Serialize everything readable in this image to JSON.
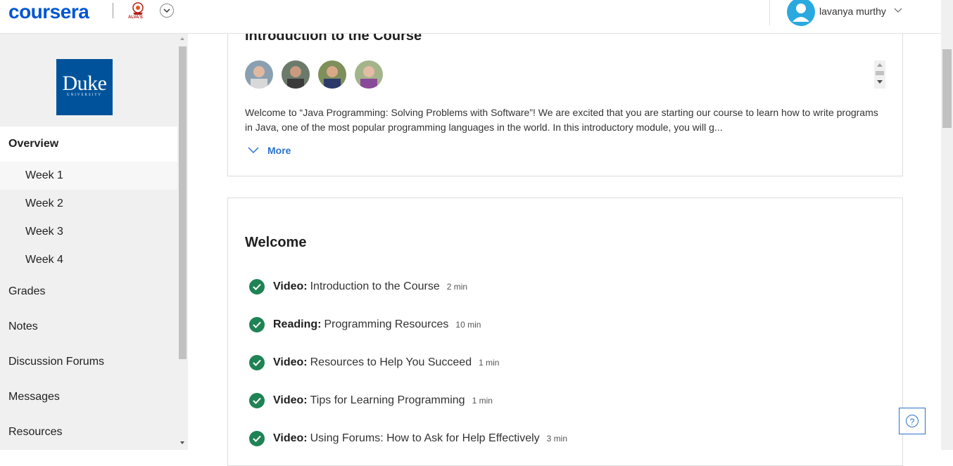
{
  "header": {
    "brand": "coursera",
    "partner_caption": "ALVA'S",
    "user_name": "lavanya murthy"
  },
  "sidebar": {
    "university_logo_text": "Duke",
    "university_logo_sub": "UNIVERSITY",
    "overview": "Overview",
    "weeks": [
      "Week 1",
      "Week 2",
      "Week 3",
      "Week 4"
    ],
    "items": [
      "Grades",
      "Notes",
      "Discussion Forums",
      "Messages",
      "Resources"
    ]
  },
  "intro": {
    "title": "Introduction to the Course",
    "description": "Welcome to “Java Programming: Solving Problems with Software”! We are excited that you are starting our course to learn how to write programs in Java, one of the most popular programming languages in the world. In this introductory module, you will g...",
    "more_label": "More"
  },
  "welcome": {
    "title": "Welcome",
    "items": [
      {
        "type": "Video:",
        "title": "Introduction to the Course",
        "duration": "2 min"
      },
      {
        "type": "Reading:",
        "title": "Programming Resources",
        "duration": "10 min"
      },
      {
        "type": "Video:",
        "title": "Resources to Help You Succeed",
        "duration": "1 min"
      },
      {
        "type": "Video:",
        "title": "Tips for Learning Programming",
        "duration": "1 min"
      },
      {
        "type": "Video:",
        "title": "Using Forums: How to Ask for Help Effectively",
        "duration": "3 min"
      }
    ]
  },
  "help": {
    "symbol": "?"
  },
  "colors": {
    "brand": "#0056d2",
    "complete": "#1f8354",
    "link": "#2a73cc",
    "duke": "#00539b"
  }
}
